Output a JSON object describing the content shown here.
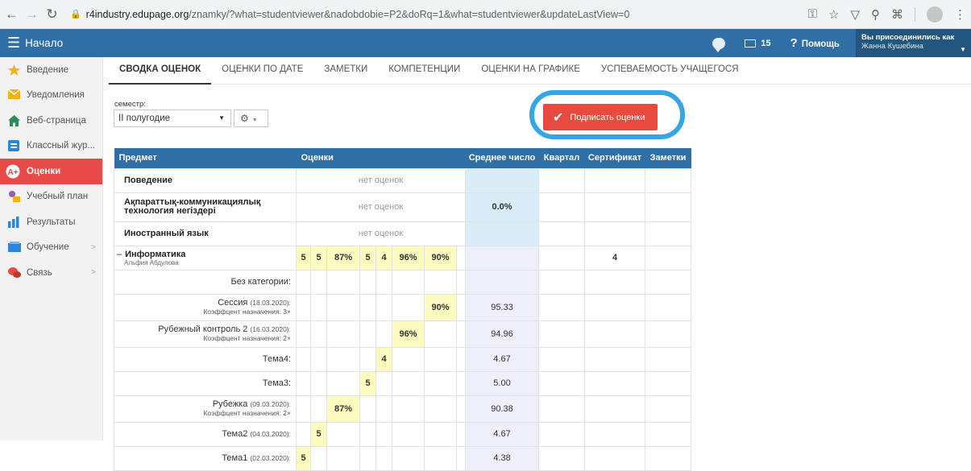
{
  "browser": {
    "url_host": "r4industry.edupage.org",
    "url_path": "/znamky/?what=studentviewer&nadobdobie=P2&doRq=1&what=studentviewer&updateLastView=0"
  },
  "header": {
    "home_label": "Начало",
    "messages_count": "15",
    "help_label": "Помощь",
    "user_line1": "Вы присоединились как",
    "user_line2": "Жанна Кушебина"
  },
  "sidebar": {
    "items": [
      {
        "label": "Введение",
        "icon": "star-icon"
      },
      {
        "label": "Уведомления",
        "icon": "envelope-icon"
      },
      {
        "label": "Веб-страница",
        "icon": "home-icon"
      },
      {
        "label": "Классный жур...",
        "icon": "journal-icon"
      },
      {
        "label": "Оценки",
        "icon": "grades-icon"
      },
      {
        "label": "Учебный план",
        "icon": "plan-icon"
      },
      {
        "label": "Результаты",
        "icon": "bar-chart-icon"
      },
      {
        "label": "Обучение",
        "icon": "book-icon"
      },
      {
        "label": "Связь",
        "icon": "chat-icon"
      }
    ]
  },
  "tabs": [
    "СВОДКА ОЦЕНОК",
    "ОЦЕНКИ ПО ДАТЕ",
    "ЗАМЕТКИ",
    "КОМПЕТЕНЦИИ",
    "ОЦЕНКИ НА ГРАФИКЕ",
    "УСПЕВАЕМОСТЬ УЧАЩЕГОСЯ"
  ],
  "filter": {
    "semester_label": "семестр:",
    "semester_value": "II полугодие"
  },
  "sign_button": "Подписать оценки",
  "table": {
    "headers": {
      "subject": "Предмет",
      "grades": "Оценки",
      "average": "Среднее число",
      "quarter": "Квартал",
      "certificate": "Сертификат",
      "notes": "Заметки"
    },
    "no_grades": "нет оценок",
    "rows": {
      "r0": {
        "subject": "Поведение"
      },
      "r1": {
        "subject": "Ақпараттық-коммуникациялық технология негіздері",
        "average": "0.0%"
      },
      "r2": {
        "subject": "Иностранный язык"
      },
      "r3": {
        "subject": "Информатика",
        "teacher": "Альфия Абдулова",
        "grades": [
          "5",
          "5",
          "87%",
          "5",
          "4",
          "96%",
          "90%"
        ],
        "certificate": "4"
      },
      "r4": {
        "label": "Без категории:"
      },
      "r5": {
        "label": "Сессия",
        "date": "(18.03.2020):",
        "coef": "Коэффцент назначения: 3×",
        "grade": "90%",
        "average": "95.33"
      },
      "r6": {
        "label": "Рубежный контроль 2",
        "date": "(16.03.2020):",
        "coef": "Коэффцент назначения: 2×",
        "grade": "96%",
        "average": "94.96"
      },
      "r7": {
        "label": "Тема4:",
        "grade": "4",
        "average": "4.67"
      },
      "r8": {
        "label": "Тема3:",
        "grade": "5",
        "average": "5.00"
      },
      "r9": {
        "label": "Рубежка",
        "date": "(09.03.2020):",
        "coef": "Коэффцент назначения: 2×",
        "grade": "87%",
        "average": "90.38"
      },
      "r10": {
        "label": "Тема2",
        "date": "(04.03.2020):",
        "grade": "5",
        "average": "4.67"
      },
      "r11": {
        "label": "Тема1",
        "date": "(02.03.2020):",
        "grade": "5",
        "average": "4.38"
      }
    }
  },
  "colors": {
    "header_blue": "#2f6fa5",
    "active_red": "#e84a48",
    "grade_yellow": "#fdfbc0",
    "average_blue": "#d9ecf8",
    "highlight_ring": "#34a6e4"
  }
}
